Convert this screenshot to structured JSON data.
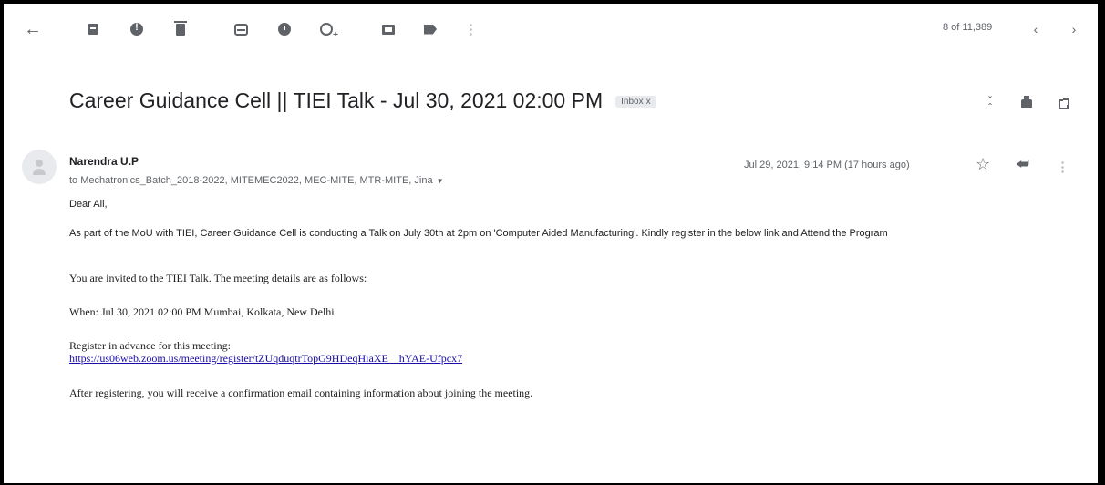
{
  "toolbar": {
    "message_count": "8 of 11,389",
    "icons": [
      "back-arrow-icon",
      "archive-icon",
      "report-spam-icon",
      "delete-icon",
      "mark-unread-icon",
      "snooze-icon",
      "add-task-icon",
      "move-to-icon",
      "label-icon",
      "more-vert-icon",
      "chevron-left-icon",
      "chevron-right-icon"
    ]
  },
  "email": {
    "subject": "Career Guidance Cell || TIEI Talk - Jul 30, 2021 02:00 PM",
    "label_chip": "Inbox",
    "label_chip_close": "x",
    "sender": "Narendra U.P",
    "recipients": "to Mechatronics_Batch_2018-2022, MITEMEC2022, MEC-MITE, MTR-MITE, Jina",
    "date": "Jul 29, 2021, 9:14 PM (17 hours ago)",
    "body": {
      "greeting": "Dear All,",
      "para1": "As part of the MoU with TIEI, Career Guidance Cell is conducting a Talk on July 30th at 2pm on 'Computer Aided Manufacturing'. Kindly register in the below link and Attend the Program",
      "invite": "You are invited to the TIEI Talk. The meeting details are as follows:",
      "when": "When: Jul 30, 2021 02:00 PM Mumbai, Kolkata, New Delhi",
      "register_label": "Register in advance for this meeting:",
      "register_link": "https://us06web.zoom.us/meeting/register/tZUqduqtrTopG9HDeqHiaXE__hYAE-Ufpcx7",
      "after": "After registering, you will receive a confirmation email containing information about joining the meeting."
    }
  }
}
